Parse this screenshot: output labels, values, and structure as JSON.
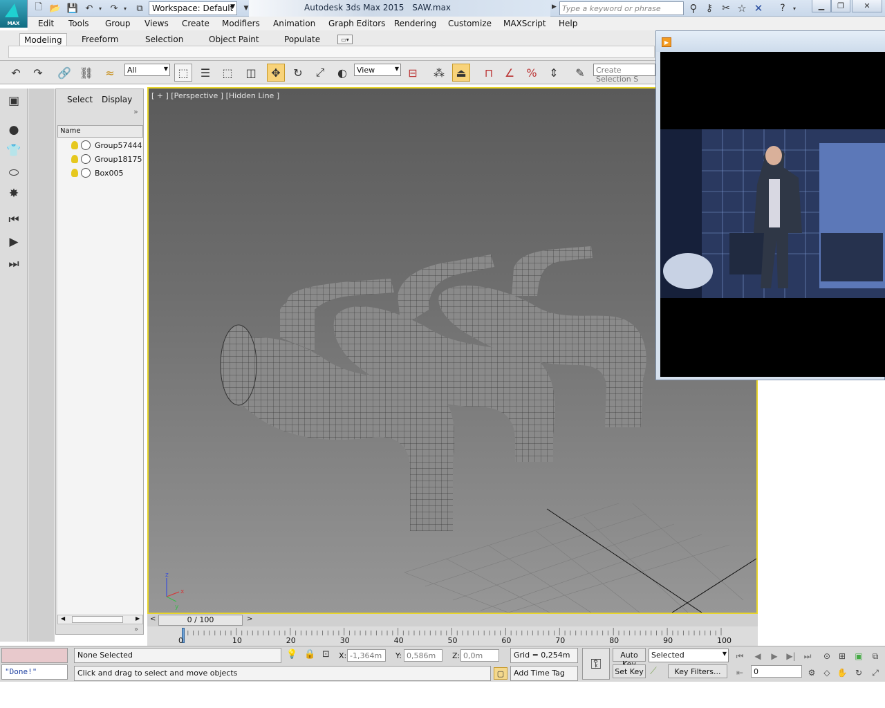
{
  "app": {
    "logo_text": "MAX",
    "title": "Autodesk 3ds Max  2015",
    "filename": "SAW.max",
    "workspace": "Workspace: Default",
    "search_placeholder": "Type a keyword or phrase"
  },
  "menu": [
    "Edit",
    "Tools",
    "Group",
    "Views",
    "Create",
    "Modifiers",
    "Animation",
    "Graph Editors",
    "Rendering",
    "Customize",
    "MAXScript",
    "Help"
  ],
  "ribbon_tabs": [
    "Modeling",
    "Freeform",
    "Selection",
    "Object Paint",
    "Populate"
  ],
  "toolbar": {
    "filter_value": "All",
    "reference_coord": "View",
    "named_selection_placeholder": "Create Selection S"
  },
  "explorer": {
    "tabs": [
      "Select",
      "Display"
    ],
    "column_header": "Name",
    "rows": [
      "Group57444",
      "Group18175",
      "Box005"
    ],
    "more": "»"
  },
  "viewport": {
    "label": "[ + ] [Perspective ] [Hidden Line ]",
    "axis_x": "x",
    "axis_y": "y",
    "axis_z": "z"
  },
  "timeline": {
    "position": "0 / 100",
    "current_frame": 0,
    "total_frames": 100,
    "ticks": [
      "0",
      "10",
      "20",
      "30",
      "40",
      "50",
      "60",
      "70",
      "80",
      "90",
      "100"
    ],
    "prev": "<",
    "next": ">"
  },
  "status": {
    "maxscript_output": "\"Done!\"",
    "selection_info": "None Selected",
    "prompt": "Click and drag to select and move objects",
    "x_label": "X:",
    "x_value": "-1,364m",
    "y_label": "Y:",
    "y_value": "0,586m",
    "z_label": "Z:",
    "z_value": "0,0m",
    "grid": "Grid = 0,254m",
    "add_time_tag": "Add Time Tag",
    "auto_key": "Auto Key",
    "set_key": "Set Key",
    "key_mode": "Selected",
    "key_filters": "Key Filters...",
    "frame_value": "0"
  }
}
